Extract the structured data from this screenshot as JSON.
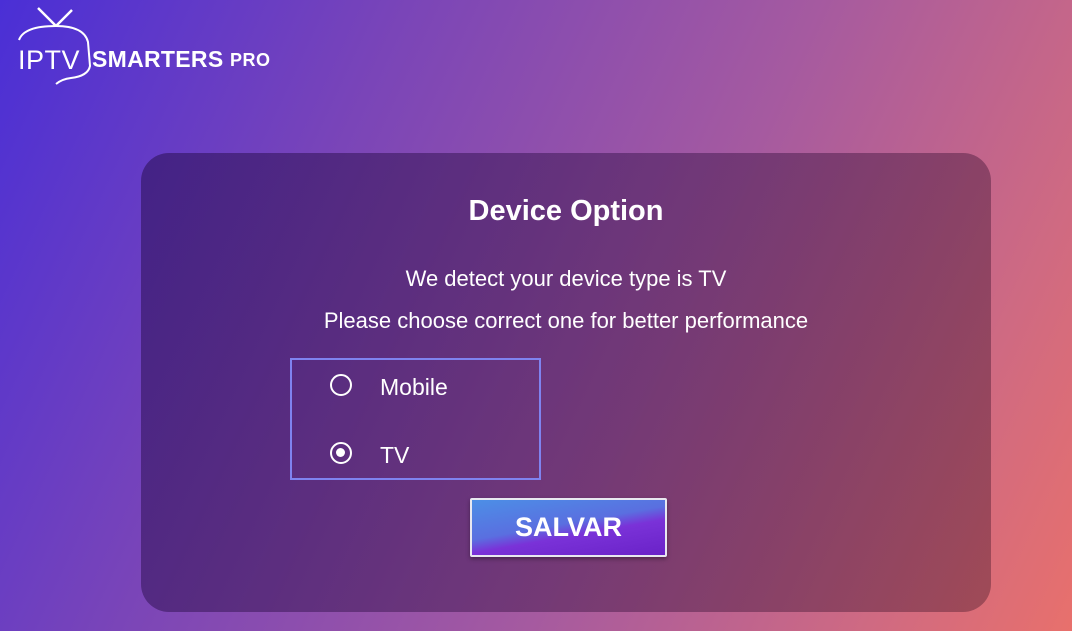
{
  "logo": {
    "iptv": "IPTV",
    "smarters": "SMARTERS",
    "pro": "PRO",
    "icon": "tv-antenna-icon"
  },
  "dialog": {
    "title": "Device Option",
    "line1": "We detect your device type is TV",
    "line2": "Please choose correct one for better performance",
    "options": [
      {
        "label": "Mobile",
        "selected": false
      },
      {
        "label": "TV",
        "selected": true
      }
    ],
    "save_label": "SALVAR"
  },
  "colors": {
    "focus_border": "#7f83f0",
    "button_gradient_top": "#4c8fe6",
    "button_gradient_bottom": "#6a22c8"
  }
}
